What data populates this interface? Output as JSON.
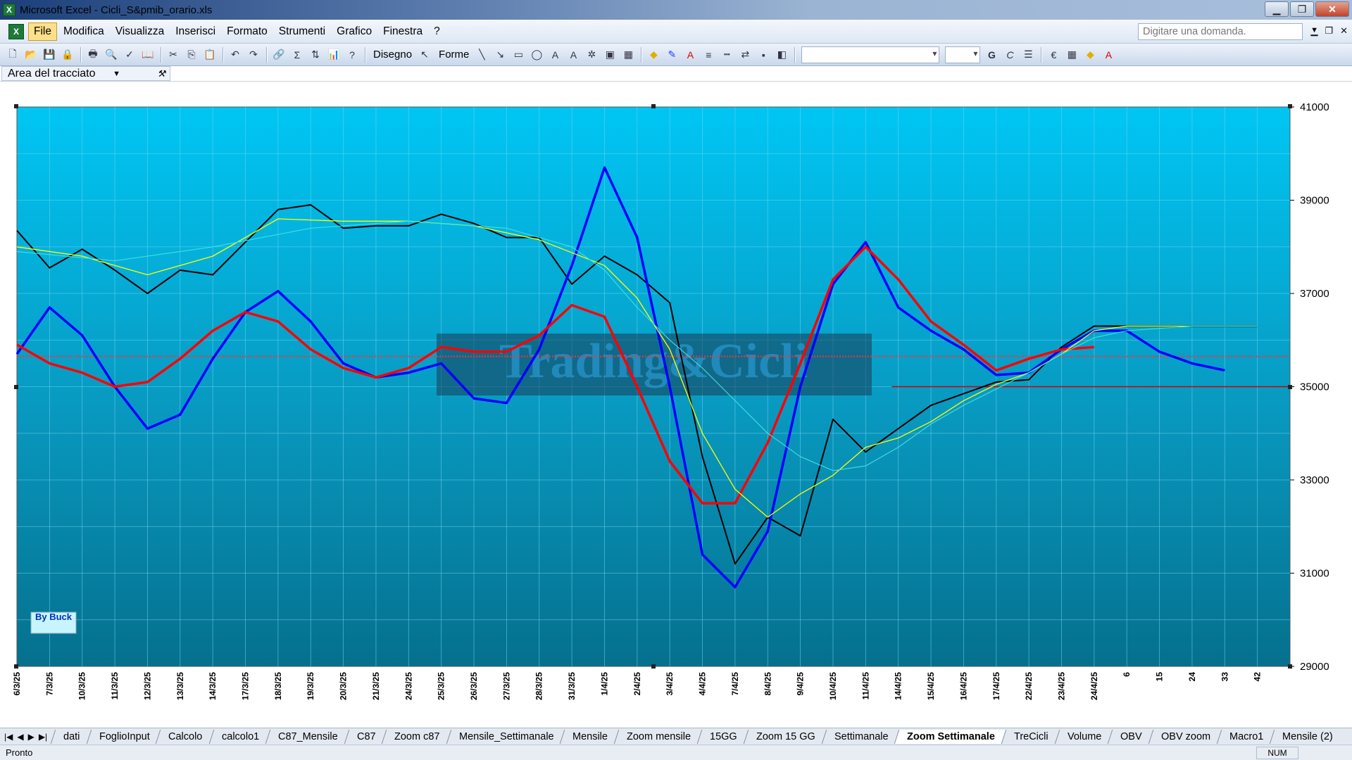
{
  "window": {
    "title": "Microsoft Excel - Cicli_S&pmib_orario.xls"
  },
  "menu": {
    "items": [
      "File",
      "Modifica",
      "Visualizza",
      "Inserisci",
      "Formato",
      "Strumenti",
      "Grafico",
      "Finestra",
      "?"
    ],
    "ask_placeholder": "Digitare una domanda."
  },
  "toolbar": {
    "draw_label": "Disegno",
    "shapes_label": "Forme"
  },
  "namebox": {
    "value": "Area del tracciato"
  },
  "chart_data": {
    "type": "line",
    "title": "",
    "watermark": "Trading&Cicli",
    "annotation": "By Buck",
    "y_axis": {
      "min": 29000,
      "max": 41000,
      "ticks": [
        "41000",
        "39000",
        "37000",
        "35000",
        "33000",
        "31000",
        "29000"
      ]
    },
    "x_labels": [
      "6/3/25",
      "7/3/25",
      "10/3/25",
      "11/3/25",
      "12/3/25",
      "13/3/25",
      "14/3/25",
      "17/3/25",
      "18/3/25",
      "19/3/25",
      "20/3/25",
      "21/3/25",
      "24/3/25",
      "25/3/25",
      "26/3/25",
      "27/3/25",
      "28/3/25",
      "31/3/25",
      "1/4/25",
      "2/4/25",
      "3/4/25",
      "4/4/25",
      "7/4/25",
      "8/4/25",
      "9/4/25",
      "10/4/25",
      "11/4/25",
      "14/4/25",
      "15/4/25",
      "16/4/25",
      "17/4/25",
      "22/4/25",
      "23/4/25",
      "24/4/25",
      "6",
      "15",
      "24",
      "33",
      "42"
    ],
    "series": [
      {
        "color": "#000000",
        "width": 2,
        "points": [
          [
            0,
            38350
          ],
          [
            1,
            37550
          ],
          [
            2,
            37950
          ],
          [
            3,
            37500
          ],
          [
            4,
            37000
          ],
          [
            5,
            37500
          ],
          [
            6,
            37400
          ],
          [
            7,
            38100
          ],
          [
            8,
            38800
          ],
          [
            9,
            38900
          ],
          [
            10,
            38400
          ],
          [
            11,
            38450
          ],
          [
            12,
            38450
          ],
          [
            13,
            38700
          ],
          [
            14,
            38500
          ],
          [
            15,
            38200
          ],
          [
            16,
            38200
          ],
          [
            17,
            37200
          ],
          [
            18,
            37800
          ],
          [
            19,
            37400
          ],
          [
            20,
            36800
          ],
          [
            21,
            33500
          ],
          [
            22,
            31200
          ],
          [
            23,
            32200
          ],
          [
            24,
            31800
          ],
          [
            25,
            34300
          ],
          [
            26,
            33600
          ],
          [
            27,
            34100
          ],
          [
            28,
            34600
          ],
          [
            29,
            34850
          ],
          [
            30,
            35100
          ],
          [
            31,
            35150
          ],
          [
            32,
            35850
          ],
          [
            33,
            36300
          ],
          [
            34,
            36300
          ],
          [
            35,
            36300
          ],
          [
            36,
            36300
          ],
          [
            37,
            36300
          ],
          [
            38,
            36300
          ]
        ]
      },
      {
        "color": "#0000ff",
        "width": 3.5,
        "points": [
          [
            0,
            35700
          ],
          [
            1,
            36700
          ],
          [
            2,
            36100
          ],
          [
            3,
            35000
          ],
          [
            4,
            34100
          ],
          [
            5,
            34400
          ],
          [
            6,
            35600
          ],
          [
            7,
            36600
          ],
          [
            8,
            37050
          ],
          [
            9,
            36400
          ],
          [
            10,
            35500
          ],
          [
            11,
            35200
          ],
          [
            12,
            35300
          ],
          [
            13,
            35500
          ],
          [
            14,
            34750
          ],
          [
            15,
            34650
          ],
          [
            16,
            35800
          ],
          [
            17,
            37600
          ],
          [
            18,
            39700
          ],
          [
            19,
            38200
          ],
          [
            20,
            35000
          ],
          [
            21,
            31400
          ],
          [
            22,
            30700
          ],
          [
            23,
            31900
          ],
          [
            24,
            35000
          ],
          [
            25,
            37200
          ],
          [
            26,
            38100
          ],
          [
            27,
            36700
          ],
          [
            28,
            36200
          ],
          [
            29,
            35800
          ],
          [
            30,
            35250
          ],
          [
            31,
            35300
          ],
          [
            32,
            35800
          ],
          [
            33,
            36200
          ],
          [
            34,
            36200
          ],
          [
            35,
            35750
          ],
          [
            36,
            35500
          ],
          [
            37,
            35350
          ]
        ]
      },
      {
        "color": "#ff0000",
        "width": 3.5,
        "points": [
          [
            0,
            35900
          ],
          [
            1,
            35500
          ],
          [
            2,
            35300
          ],
          [
            3,
            35000
          ],
          [
            4,
            35100
          ],
          [
            5,
            35600
          ],
          [
            6,
            36200
          ],
          [
            7,
            36600
          ],
          [
            8,
            36400
          ],
          [
            9,
            35800
          ],
          [
            10,
            35400
          ],
          [
            11,
            35200
          ],
          [
            12,
            35400
          ],
          [
            13,
            35850
          ],
          [
            14,
            35750
          ],
          [
            15,
            35750
          ],
          [
            16,
            36100
          ],
          [
            17,
            36750
          ],
          [
            18,
            36500
          ],
          [
            19,
            35000
          ],
          [
            20,
            33400
          ],
          [
            21,
            32500
          ],
          [
            22,
            32500
          ],
          [
            23,
            33800
          ],
          [
            24,
            35500
          ],
          [
            25,
            37300
          ],
          [
            26,
            38000
          ],
          [
            27,
            37300
          ],
          [
            28,
            36400
          ],
          [
            29,
            35900
          ],
          [
            30,
            35350
          ],
          [
            31,
            35600
          ],
          [
            32,
            35800
          ],
          [
            33,
            35850
          ]
        ]
      },
      {
        "color": "#ffff00",
        "width": 1.3,
        "points": [
          [
            0,
            38000
          ],
          [
            2,
            37800
          ],
          [
            4,
            37400
          ],
          [
            6,
            37800
          ],
          [
            8,
            38600
          ],
          [
            10,
            38550
          ],
          [
            12,
            38550
          ],
          [
            14,
            38450
          ],
          [
            16,
            38150
          ],
          [
            18,
            37600
          ],
          [
            19,
            36900
          ],
          [
            20,
            35800
          ],
          [
            21,
            34000
          ],
          [
            22,
            32800
          ],
          [
            23,
            32200
          ],
          [
            24,
            32700
          ],
          [
            25,
            33100
          ],
          [
            26,
            33700
          ],
          [
            27,
            33900
          ],
          [
            28,
            34250
          ],
          [
            29,
            34700
          ],
          [
            30,
            35050
          ],
          [
            31,
            35300
          ],
          [
            32,
            35700
          ],
          [
            33,
            36200
          ],
          [
            34,
            36300
          ],
          [
            36,
            36300
          ],
          [
            38,
            36300
          ]
        ]
      },
      {
        "color": "#40e0e0",
        "width": 1.1,
        "points": [
          [
            0,
            37900
          ],
          [
            3,
            37700
          ],
          [
            6,
            38000
          ],
          [
            9,
            38400
          ],
          [
            12,
            38550
          ],
          [
            15,
            38400
          ],
          [
            17,
            38000
          ],
          [
            18,
            37500
          ],
          [
            19,
            36700
          ],
          [
            20,
            36000
          ],
          [
            21,
            35400
          ],
          [
            22,
            34700
          ],
          [
            23,
            34000
          ],
          [
            24,
            33500
          ],
          [
            25,
            33200
          ],
          [
            26,
            33300
          ],
          [
            27,
            33700
          ],
          [
            28,
            34200
          ],
          [
            29,
            34600
          ],
          [
            30,
            34950
          ],
          [
            31,
            35300
          ],
          [
            32,
            35700
          ],
          [
            33,
            36050
          ],
          [
            34,
            36200
          ],
          [
            36,
            36300
          ],
          [
            38,
            36300
          ]
        ]
      }
    ],
    "h_lines": [
      {
        "value": 35650,
        "color": "#ff3030",
        "style": "dotted"
      },
      {
        "value": 35000,
        "color": "#d00000",
        "from_index": 26.8,
        "style": "solid"
      }
    ]
  },
  "sheet_tabs": {
    "tabs": [
      "dati",
      "FoglioInput",
      "Calcolo",
      "calcolo1",
      "C87_Mensile",
      "C87",
      "Zoom c87",
      "Mensile_Settimanale",
      "Mensile",
      "Zoom mensile",
      "15GG",
      "Zoom 15 GG",
      "Settimanale",
      "Zoom Settimanale",
      "TreCicli",
      "Volume",
      "OBV",
      "OBV zoom",
      "Macro1",
      "Mensile (2)"
    ],
    "active": "Zoom Settimanale"
  },
  "status": {
    "left": "Pronto",
    "num": "NUM"
  }
}
